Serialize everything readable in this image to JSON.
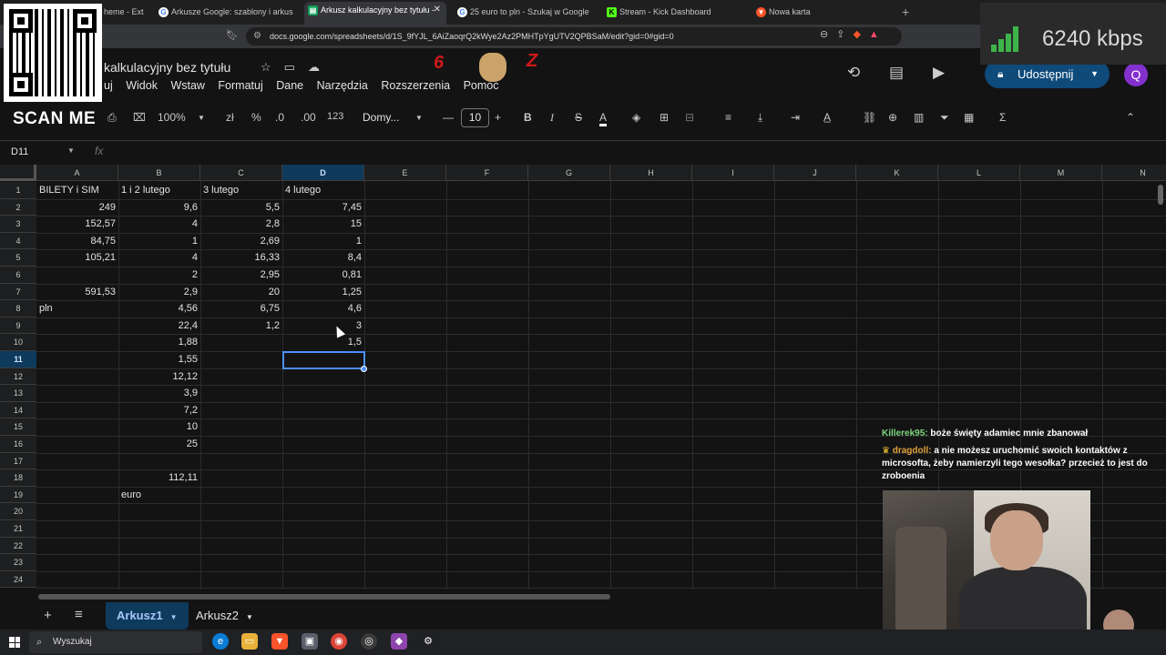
{
  "browser": {
    "tabs": [
      {
        "label": "heme - Ext",
        "active": false
      },
      {
        "label": "Arkusze Google: szablony i arkusze k",
        "active": false
      },
      {
        "label": "Arkusz kalkulacyjny bez tytułu - ",
        "active": true
      },
      {
        "label": "25 euro to pln - Szukaj w Google",
        "active": false
      },
      {
        "label": "Stream - Kick Dashboard",
        "active": false
      },
      {
        "label": "Nowa karta",
        "active": false
      }
    ],
    "new_tab": "+",
    "url": "docs.google.com/spreadsheets/d/1S_9fYJL_6AiZaoqrQ2kWye2Az2PMHTpYgUTV2QPBSaM/edit?gid=0#gid=0"
  },
  "overlay": {
    "scan_me": "SCAN ME",
    "bitrate": "6240 kbps",
    "sticker_left": "6",
    "sticker_right": "Z"
  },
  "sheets": {
    "title": "kalkulacyjny bez tytułu",
    "menus": [
      "uj",
      "Widok",
      "Wstaw",
      "Formatuj",
      "Dane",
      "Narzędzia",
      "Rozszerzenia",
      "Pomoc"
    ],
    "share": "Udostępnij",
    "avatar": "Q",
    "toolbar": {
      "zoom": "100%",
      "currency": "zł",
      "percent": "%",
      "dec_dec": ".0",
      "dec_inc": ".00",
      "format": "123",
      "font": "Domy...",
      "font_size": "10",
      "bold": "B",
      "italic": "I",
      "strike": "S",
      "text_color": "A",
      "sigma": "Σ"
    },
    "name_box": "D11",
    "fx": "fx",
    "columns": [
      "A",
      "B",
      "C",
      "D",
      "E",
      "F",
      "G",
      "H",
      "I",
      "J",
      "K",
      "L",
      "M",
      "N"
    ],
    "selected_column": "D",
    "rows": [
      "1",
      "2",
      "3",
      "4",
      "5",
      "6",
      "7",
      "8",
      "9",
      "10",
      "11",
      "12",
      "13",
      "14",
      "15",
      "16",
      "17",
      "18",
      "19",
      "20",
      "21",
      "22",
      "23",
      "24"
    ],
    "selected_row": "11",
    "cells": {
      "A": [
        "BILETY i SIM",
        "249",
        "152,57",
        "84,75",
        "105,21",
        "",
        "591,53",
        "pln",
        "",
        "",
        "",
        "",
        "",
        "",
        "",
        "",
        "",
        "",
        "",
        "",
        "",
        "",
        "",
        ""
      ],
      "B": [
        "1 i 2 lutego",
        "9,6",
        "4",
        "1",
        "4",
        "2",
        "2,9",
        "4,56",
        "22,4",
        "1,88",
        "1,55",
        "12,12",
        "3,9",
        "7,2",
        "10",
        "25",
        "",
        "112,11",
        "euro",
        "",
        "",
        "",
        "",
        ""
      ],
      "C": [
        "3 lutego",
        "5,5",
        "2,8",
        "2,69",
        "16,33",
        "2,95",
        "20",
        "6,75",
        "1,2",
        "",
        "",
        "",
        "",
        "",
        "",
        "",
        "",
        "",
        "",
        "",
        "",
        "",
        "",
        ""
      ],
      "D": [
        "4 lutego",
        "7,45",
        "15",
        "1",
        "8,4",
        "0,81",
        "1,25",
        "4,6",
        "3",
        "1,5",
        "",
        "",
        "",
        "",
        "",
        "",
        "",
        "",
        "",
        "",
        "",
        "",
        "",
        ""
      ]
    },
    "sheet_tabs": [
      {
        "label": "Arkusz1",
        "active": true
      },
      {
        "label": "Arkusz2",
        "active": false
      }
    ]
  },
  "chat": [
    {
      "user": "Killerek95:",
      "text": "boże święty adamiec mnie zbanował"
    },
    {
      "user": "dragdoll:",
      "text": "a nie możesz uruchomić swoich kontaktów z microsofta, żeby namierzyli tego wesołka? przecież to jest do zroboenia"
    }
  ],
  "taskbar": {
    "search_placeholder": "Wyszukaj"
  }
}
